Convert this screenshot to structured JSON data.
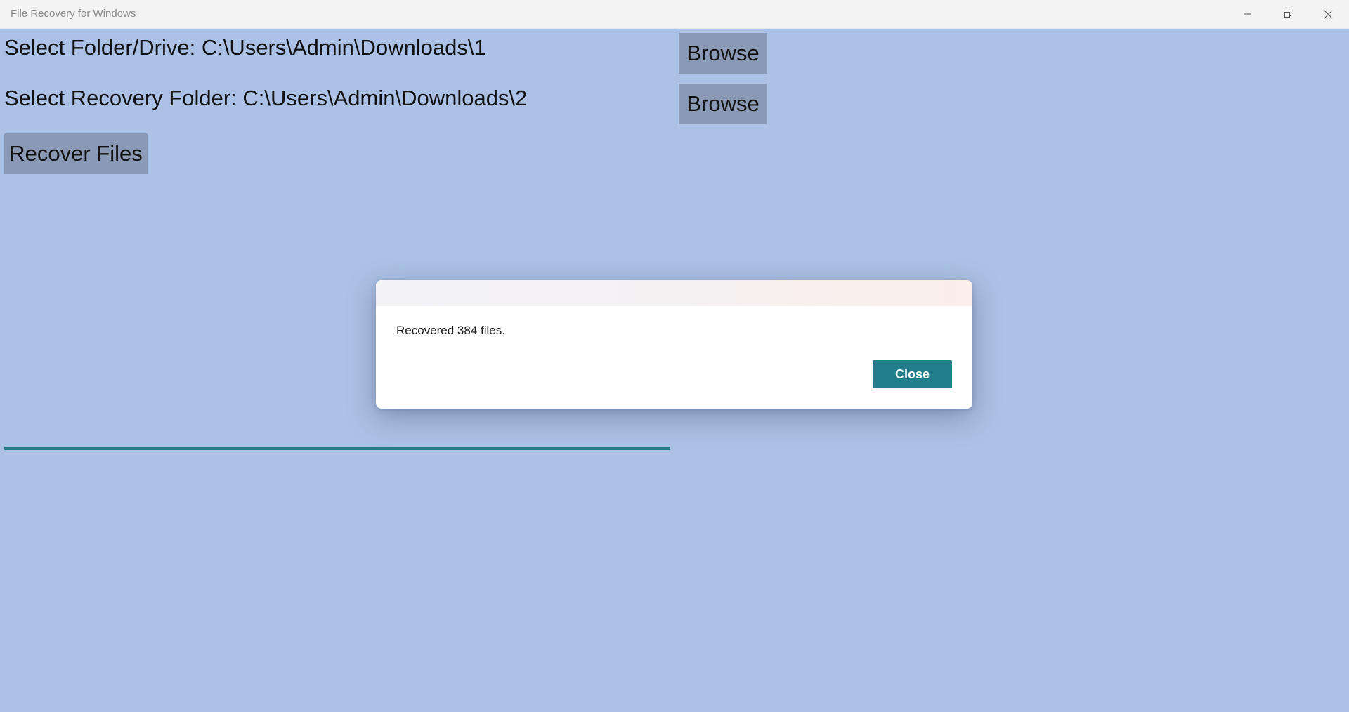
{
  "window": {
    "title": "File Recovery for Windows",
    "controls": {
      "minimize_icon": "minimize-icon",
      "maximize_icon": "restore-icon",
      "close_icon": "close-icon"
    }
  },
  "main": {
    "source_label": "Select Folder/Drive: C:\\Users\\Admin\\Downloads\\1",
    "source_browse_label": "Browse",
    "dest_label": "Select Recovery Folder: C:\\Users\\Admin\\Downloads\\2",
    "dest_browse_label": "Browse",
    "recover_label": "Recover Files",
    "progress_fraction": 1.0
  },
  "dialog": {
    "message": "Recovered 384 files.",
    "close_label": "Close"
  },
  "colors": {
    "background": "#abc1e5",
    "button_gray": "#8a9ab6",
    "accent": "#237e8c"
  }
}
